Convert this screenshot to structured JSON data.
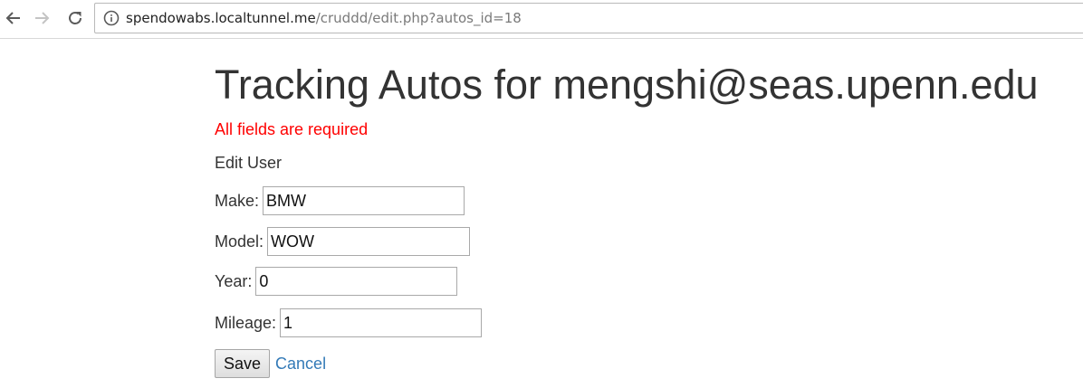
{
  "browser": {
    "url_host": "spendowabs.localtunnel.me",
    "url_path": "/cruddd/edit.php?autos_id=18"
  },
  "page": {
    "title": "Tracking Autos for mengshi@seas.upenn.edu",
    "error_message": "All fields are required",
    "subtitle": "Edit User",
    "colors": {
      "error": "#ff0000",
      "link": "#337ab7",
      "text": "#333333"
    }
  },
  "form": {
    "make": {
      "label": "Make:",
      "value": "BMW"
    },
    "model": {
      "label": "Model:",
      "value": "WOW"
    },
    "year": {
      "label": "Year:",
      "value": "0"
    },
    "mileage": {
      "label": "Mileage:",
      "value": "1"
    },
    "save_label": "Save",
    "cancel_label": "Cancel"
  },
  "icons": [
    "back-icon",
    "forward-icon",
    "reload-icon",
    "info-icon"
  ]
}
